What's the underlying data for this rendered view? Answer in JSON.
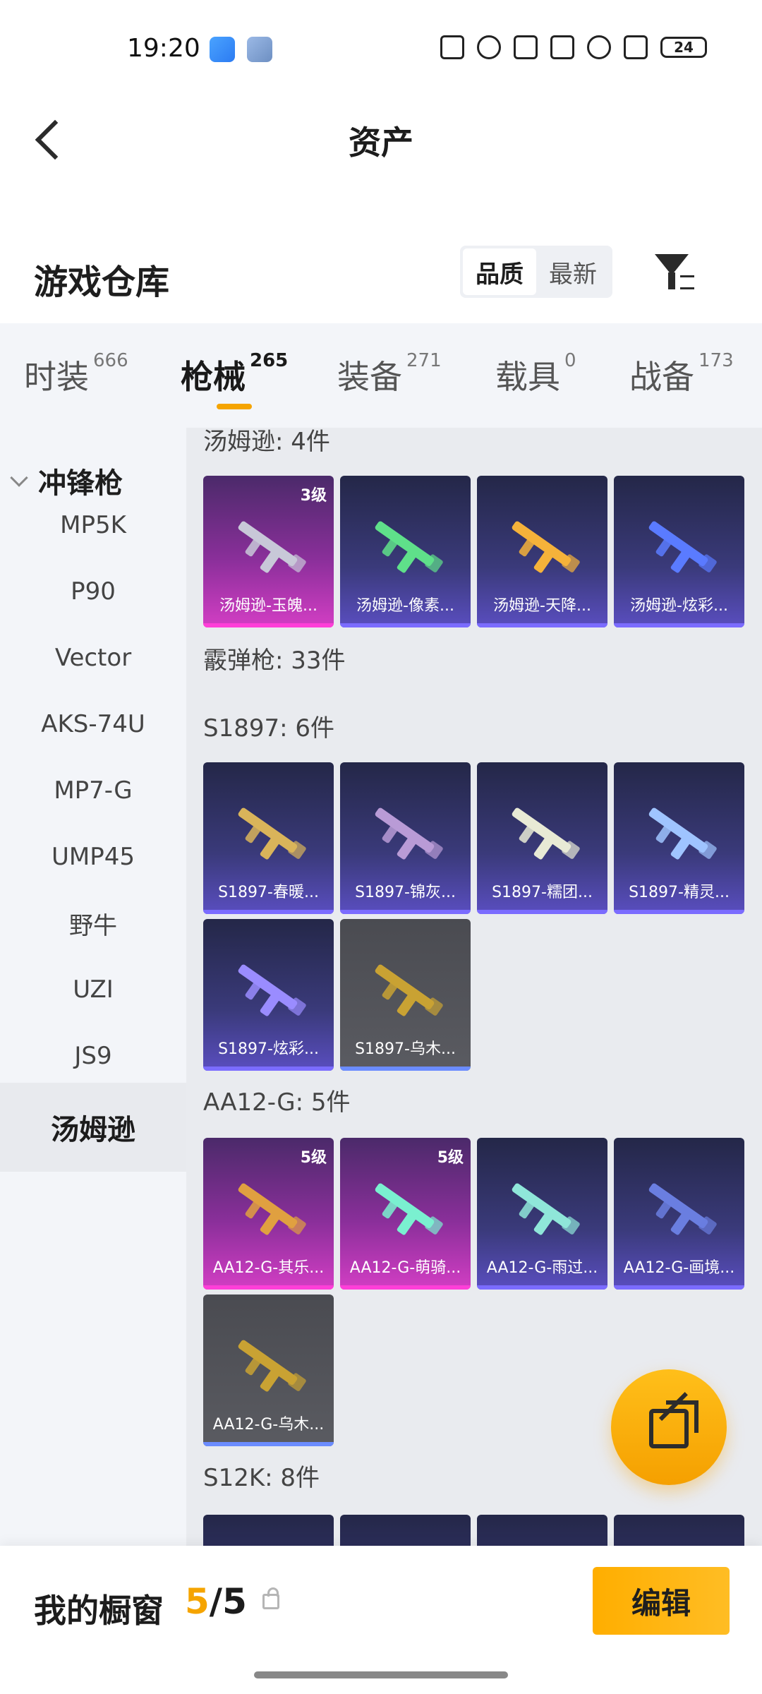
{
  "status": {
    "time": "19:20",
    "battery": "24"
  },
  "header": {
    "title": "资产"
  },
  "section": {
    "title": "游戏仓库",
    "sort_options": [
      "品质",
      "最新"
    ],
    "active_sort": "品质"
  },
  "tabs": [
    {
      "label": "时装",
      "count": "666"
    },
    {
      "label": "枪械",
      "count": "265"
    },
    {
      "label": "装备",
      "count": "271"
    },
    {
      "label": "载具",
      "count": "0"
    },
    {
      "label": "战备",
      "count": "173"
    }
  ],
  "active_tab": "枪械",
  "sidebar": {
    "category": "冲锋枪",
    "items": [
      "MP5K",
      "P90",
      "Vector",
      "AKS-74U",
      "MP7-G",
      "UMP45",
      "野牛",
      "UZI",
      "JS9",
      "汤姆逊"
    ],
    "active_item": "汤姆逊"
  },
  "groups": [
    {
      "title": "汤姆逊: 4件",
      "items": [
        {
          "name": "汤姆逊-玉魄...",
          "rarity": "pink",
          "level": "3级",
          "color": "#c8c8d8"
        },
        {
          "name": "汤姆逊-像素...",
          "rarity": "blue",
          "level": "",
          "color": "#5fe08a"
        },
        {
          "name": "汤姆逊-天降...",
          "rarity": "blue",
          "level": "",
          "color": "#f5b23a"
        },
        {
          "name": "汤姆逊-炫彩...",
          "rarity": "blue",
          "level": "",
          "color": "#5a7bff"
        }
      ]
    },
    {
      "title": "霰弹枪: 33件",
      "items": []
    },
    {
      "title": "S1897: 6件",
      "items": [
        {
          "name": "S1897-春暖...",
          "rarity": "blue",
          "level": "",
          "color": "#d9b45a"
        },
        {
          "name": "S1897-锦灰...",
          "rarity": "blue",
          "level": "",
          "color": "#b99bd6"
        },
        {
          "name": "S1897-糯团...",
          "rarity": "blue",
          "level": "",
          "color": "#e8ead5"
        },
        {
          "name": "S1897-精灵...",
          "rarity": "blue",
          "level": "",
          "color": "#9fc4ff"
        },
        {
          "name": "S1897-炫彩...",
          "rarity": "blue",
          "level": "",
          "color": "#9a8cff"
        },
        {
          "name": "S1897-乌木...",
          "rarity": "gray",
          "level": "",
          "color": "#c9a233"
        }
      ]
    },
    {
      "title": "AA12-G: 5件",
      "items": [
        {
          "name": "AA12-G-其乐...",
          "rarity": "pink",
          "level": "5级",
          "color": "#e0a040"
        },
        {
          "name": "AA12-G-萌骑...",
          "rarity": "pink",
          "level": "5级",
          "color": "#7af0d0"
        },
        {
          "name": "AA12-G-雨过...",
          "rarity": "blue",
          "level": "",
          "color": "#8fe6d9"
        },
        {
          "name": "AA12-G-画境...",
          "rarity": "blue",
          "level": "",
          "color": "#6a7ee0"
        },
        {
          "name": "AA12-G-乌木...",
          "rarity": "gray",
          "level": "",
          "color": "#c9a233"
        }
      ]
    },
    {
      "title": "S12K: 8件",
      "items": [
        {
          "name": "",
          "rarity": "blue",
          "level": "",
          "color": "#7f8dff"
        },
        {
          "name": "",
          "rarity": "blue",
          "level": "",
          "color": "#7f8dff"
        },
        {
          "name": "",
          "rarity": "blue",
          "level": "",
          "color": "#7f8dff"
        },
        {
          "name": "",
          "rarity": "blue",
          "level": "",
          "color": "#7f8dff"
        }
      ]
    }
  ],
  "bottom": {
    "my_window": "我的橱窗",
    "current": "5",
    "separator": "/",
    "total": "5",
    "edit_label": "编辑"
  },
  "colors": {
    "accent": "#f5a400",
    "rarity_pink": "#d33ec4",
    "rarity_blue": "#5a4ec0",
    "rarity_gray": "#5a5b61"
  }
}
